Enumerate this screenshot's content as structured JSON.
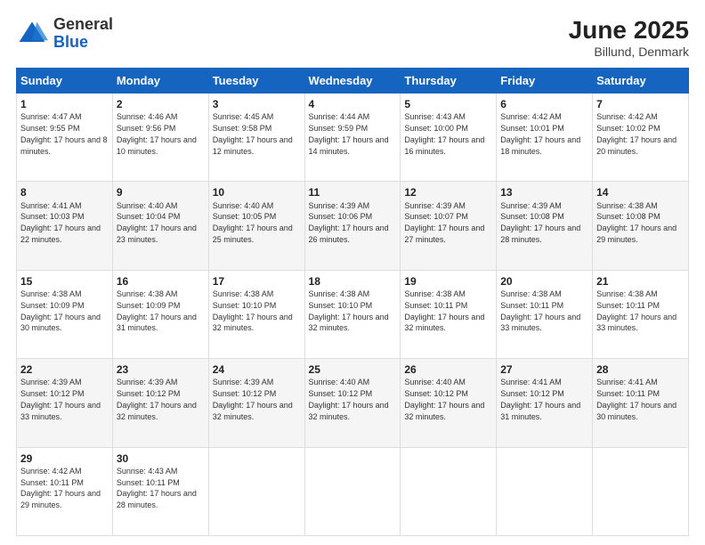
{
  "header": {
    "logo_general": "General",
    "logo_blue": "Blue",
    "month_year": "June 2025",
    "location": "Billund, Denmark"
  },
  "days_of_week": [
    "Sunday",
    "Monday",
    "Tuesday",
    "Wednesday",
    "Thursday",
    "Friday",
    "Saturday"
  ],
  "weeks": [
    [
      {
        "day": 1,
        "detail": "Sunrise: 4:47 AM\nSunset: 9:55 PM\nDaylight: 17 hours and 8 minutes."
      },
      {
        "day": 2,
        "detail": "Sunrise: 4:46 AM\nSunset: 9:56 PM\nDaylight: 17 hours and 10 minutes."
      },
      {
        "day": 3,
        "detail": "Sunrise: 4:45 AM\nSunset: 9:58 PM\nDaylight: 17 hours and 12 minutes."
      },
      {
        "day": 4,
        "detail": "Sunrise: 4:44 AM\nSunset: 9:59 PM\nDaylight: 17 hours and 14 minutes."
      },
      {
        "day": 5,
        "detail": "Sunrise: 4:43 AM\nSunset: 10:00 PM\nDaylight: 17 hours and 16 minutes."
      },
      {
        "day": 6,
        "detail": "Sunrise: 4:42 AM\nSunset: 10:01 PM\nDaylight: 17 hours and 18 minutes."
      },
      {
        "day": 7,
        "detail": "Sunrise: 4:42 AM\nSunset: 10:02 PM\nDaylight: 17 hours and 20 minutes."
      }
    ],
    [
      {
        "day": 8,
        "detail": "Sunrise: 4:41 AM\nSunset: 10:03 PM\nDaylight: 17 hours and 22 minutes."
      },
      {
        "day": 9,
        "detail": "Sunrise: 4:40 AM\nSunset: 10:04 PM\nDaylight: 17 hours and 23 minutes."
      },
      {
        "day": 10,
        "detail": "Sunrise: 4:40 AM\nSunset: 10:05 PM\nDaylight: 17 hours and 25 minutes."
      },
      {
        "day": 11,
        "detail": "Sunrise: 4:39 AM\nSunset: 10:06 PM\nDaylight: 17 hours and 26 minutes."
      },
      {
        "day": 12,
        "detail": "Sunrise: 4:39 AM\nSunset: 10:07 PM\nDaylight: 17 hours and 27 minutes."
      },
      {
        "day": 13,
        "detail": "Sunrise: 4:39 AM\nSunset: 10:08 PM\nDaylight: 17 hours and 28 minutes."
      },
      {
        "day": 14,
        "detail": "Sunrise: 4:38 AM\nSunset: 10:08 PM\nDaylight: 17 hours and 29 minutes."
      }
    ],
    [
      {
        "day": 15,
        "detail": "Sunrise: 4:38 AM\nSunset: 10:09 PM\nDaylight: 17 hours and 30 minutes."
      },
      {
        "day": 16,
        "detail": "Sunrise: 4:38 AM\nSunset: 10:09 PM\nDaylight: 17 hours and 31 minutes."
      },
      {
        "day": 17,
        "detail": "Sunrise: 4:38 AM\nSunset: 10:10 PM\nDaylight: 17 hours and 32 minutes."
      },
      {
        "day": 18,
        "detail": "Sunrise: 4:38 AM\nSunset: 10:10 PM\nDaylight: 17 hours and 32 minutes."
      },
      {
        "day": 19,
        "detail": "Sunrise: 4:38 AM\nSunset: 10:11 PM\nDaylight: 17 hours and 32 minutes."
      },
      {
        "day": 20,
        "detail": "Sunrise: 4:38 AM\nSunset: 10:11 PM\nDaylight: 17 hours and 33 minutes."
      },
      {
        "day": 21,
        "detail": "Sunrise: 4:38 AM\nSunset: 10:11 PM\nDaylight: 17 hours and 33 minutes."
      }
    ],
    [
      {
        "day": 22,
        "detail": "Sunrise: 4:39 AM\nSunset: 10:12 PM\nDaylight: 17 hours and 33 minutes."
      },
      {
        "day": 23,
        "detail": "Sunrise: 4:39 AM\nSunset: 10:12 PM\nDaylight: 17 hours and 32 minutes."
      },
      {
        "day": 24,
        "detail": "Sunrise: 4:39 AM\nSunset: 10:12 PM\nDaylight: 17 hours and 32 minutes."
      },
      {
        "day": 25,
        "detail": "Sunrise: 4:40 AM\nSunset: 10:12 PM\nDaylight: 17 hours and 32 minutes."
      },
      {
        "day": 26,
        "detail": "Sunrise: 4:40 AM\nSunset: 10:12 PM\nDaylight: 17 hours and 32 minutes."
      },
      {
        "day": 27,
        "detail": "Sunrise: 4:41 AM\nSunset: 10:12 PM\nDaylight: 17 hours and 31 minutes."
      },
      {
        "day": 28,
        "detail": "Sunrise: 4:41 AM\nSunset: 10:11 PM\nDaylight: 17 hours and 30 minutes."
      }
    ],
    [
      {
        "day": 29,
        "detail": "Sunrise: 4:42 AM\nSunset: 10:11 PM\nDaylight: 17 hours and 29 minutes."
      },
      {
        "day": 30,
        "detail": "Sunrise: 4:43 AM\nSunset: 10:11 PM\nDaylight: 17 hours and 28 minutes."
      },
      null,
      null,
      null,
      null,
      null
    ]
  ]
}
